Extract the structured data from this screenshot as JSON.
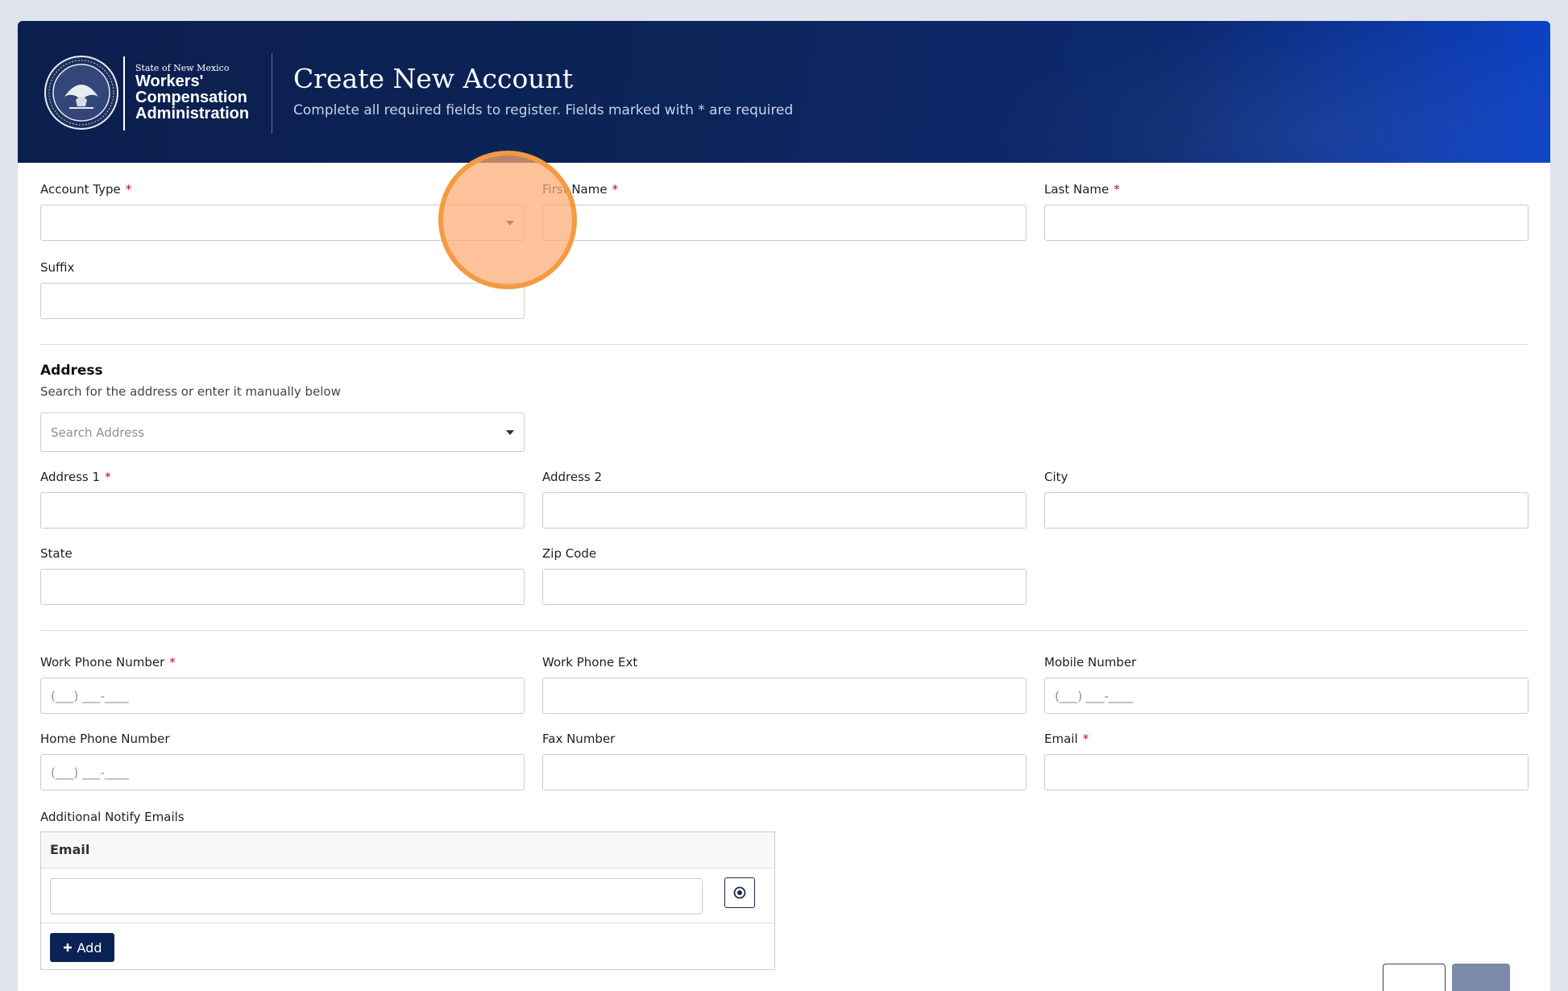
{
  "header": {
    "logo": {
      "state_line": "State of New Mexico",
      "org_line1": "Workers'",
      "org_line2": "Compensation",
      "org_line3": "Administration",
      "seal_icon": "state-seal-icon"
    },
    "title": "Create New Account",
    "subtitle": "Complete all required fields to register. Fields marked with * are required"
  },
  "account": {
    "account_type_label": "Account Type",
    "first_name_label": "First Name",
    "last_name_label": "Last Name",
    "suffix_label": "Suffix",
    "required_mark": "*"
  },
  "address": {
    "title": "Address",
    "subtitle": "Search for the address or enter it manually below",
    "search_placeholder": "Search Address",
    "address1_label": "Address 1",
    "address2_label": "Address 2",
    "city_label": "City",
    "state_label": "State",
    "zip_label": "Zip Code"
  },
  "contact": {
    "work_phone_label": "Work Phone Number",
    "work_ext_label": "Work Phone Ext",
    "mobile_label": "Mobile Number",
    "home_phone_label": "Home Phone Number",
    "fax_label": "Fax Number",
    "email_label": "Email",
    "phone_mask": "(___) ___-____"
  },
  "notify": {
    "label": "Additional Notify Emails",
    "column_header": "Email",
    "remove_icon": "remove-circle-icon",
    "add_icon": "plus-icon",
    "add_label": "Add"
  },
  "colors": {
    "banner": "#0b1f4e",
    "required": "#d0021b",
    "primary_button": "#0b2255",
    "click_highlight": "#f59a42"
  }
}
